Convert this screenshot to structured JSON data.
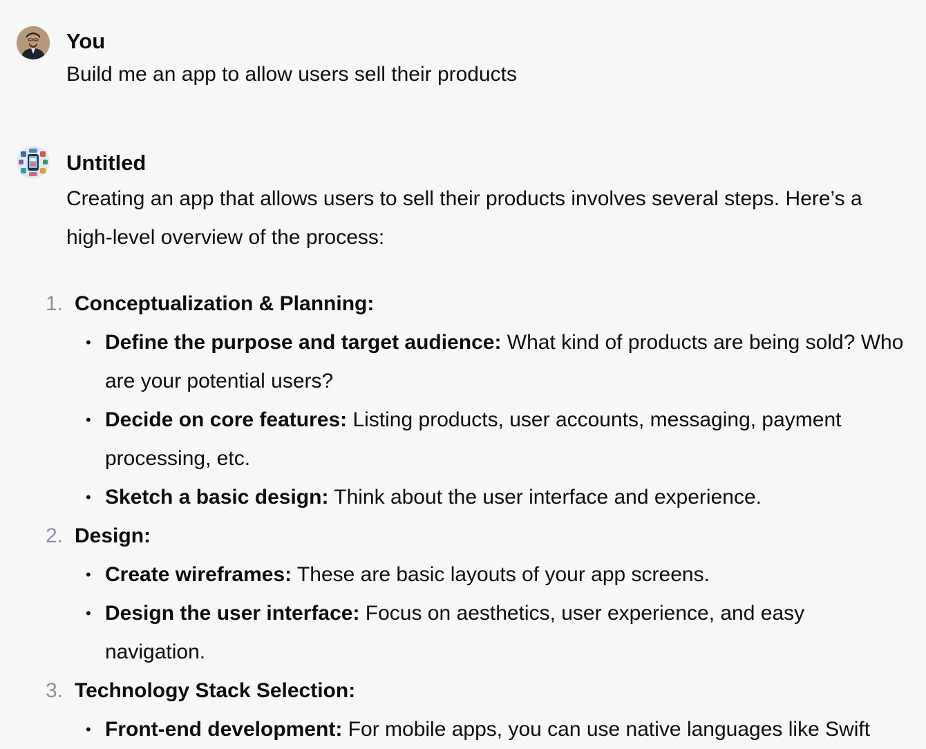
{
  "messages": {
    "user": {
      "author": "You",
      "text": "Build me an app to allow users sell their products"
    },
    "assistant": {
      "author": "Untitled",
      "intro": "Creating an app that allows users to sell their products involves several steps. Here’s a high-level overview of the process:",
      "steps": [
        {
          "number": "1.",
          "title": "Conceptualization & Planning:",
          "items": [
            {
              "label": "Define the purpose and target audience:",
              "text": " What kind of products are being sold? Who are your potential users?"
            },
            {
              "label": "Decide on core features:",
              "text": " Listing products, user accounts, messaging, payment processing, etc."
            },
            {
              "label": "Sketch a basic design:",
              "text": " Think about the user interface and experience."
            }
          ]
        },
        {
          "number": "2.",
          "title": "Design:",
          "items": [
            {
              "label": "Create wireframes:",
              "text": " These are basic layouts of your app screens."
            },
            {
              "label": "Design the user interface:",
              "text": " Focus on aesthetics, user experience, and easy navigation."
            }
          ]
        },
        {
          "number": "3.",
          "title": "Technology Stack Selection:",
          "items": [
            {
              "label": "Front-end development:",
              "text": " For mobile apps, you can use native languages like Swift"
            }
          ]
        }
      ]
    }
  },
  "icons": {
    "user_avatar": "user-avatar-icon",
    "gpt_avatar": "gpt-avatar-icon",
    "bullet": "bullet-icon"
  },
  "colors": {
    "background": "#f7f7f8",
    "text": "#0d0d0d",
    "list_number": "#8e8ea0"
  }
}
